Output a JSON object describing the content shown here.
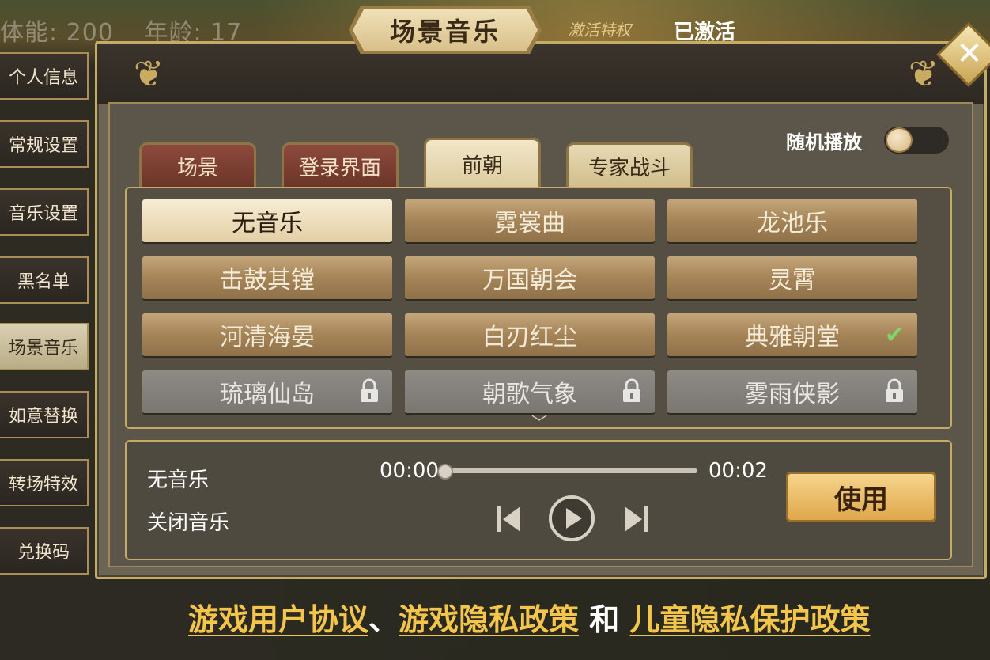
{
  "top_stats": {
    "stamina": "体能: 200",
    "age": "年龄: 17"
  },
  "sidebar": {
    "items": [
      {
        "label": "个人信息",
        "active": false
      },
      {
        "label": "常规设置",
        "active": false
      },
      {
        "label": "音乐设置",
        "active": false
      },
      {
        "label": "黑名单",
        "active": false
      },
      {
        "label": "场景音乐",
        "active": true
      },
      {
        "label": "如意替换",
        "active": false
      },
      {
        "label": "转场特效",
        "active": false
      },
      {
        "label": "兑换码",
        "active": false
      }
    ]
  },
  "header": {
    "title": "场景音乐",
    "privilege_label": "激活特权",
    "privilege_status": "已激活"
  },
  "tabs": [
    {
      "label": "场景",
      "style": "red"
    },
    {
      "label": "登录界面",
      "style": "red"
    },
    {
      "label": "前朝",
      "style": "active"
    },
    {
      "label": "专家战斗",
      "style": "light"
    }
  ],
  "random_play": {
    "label": "随机播放",
    "enabled": false
  },
  "songs": [
    {
      "title": "无音乐",
      "state": "selected"
    },
    {
      "title": "霓裳曲",
      "state": "normal"
    },
    {
      "title": "龙池乐",
      "state": "normal"
    },
    {
      "title": "击鼓其镗",
      "state": "normal"
    },
    {
      "title": "万国朝会",
      "state": "normal"
    },
    {
      "title": "灵霄",
      "state": "normal"
    },
    {
      "title": "河清海晏",
      "state": "normal"
    },
    {
      "title": "白刃红尘",
      "state": "normal"
    },
    {
      "title": "典雅朝堂",
      "state": "in-use"
    },
    {
      "title": "琉璃仙岛",
      "state": "locked"
    },
    {
      "title": "朝歌气象",
      "state": "locked"
    },
    {
      "title": "雾雨侠影",
      "state": "locked"
    }
  ],
  "player": {
    "now_playing": "无音乐",
    "subtitle": "关闭音乐",
    "current_time": "00:00",
    "total_time": "00:02",
    "progress": 0.0,
    "use_label": "使用"
  },
  "footer": {
    "user_agreement": "游戏用户协议",
    "separator": "、",
    "privacy_policy": "游戏隐私政策",
    "and": "和",
    "child_privacy": "儿童隐私保护政策"
  }
}
